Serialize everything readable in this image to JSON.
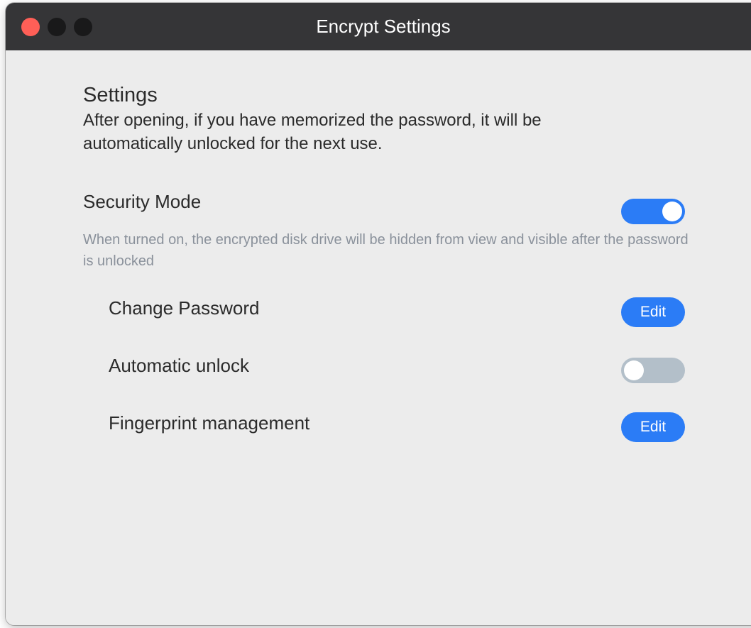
{
  "window": {
    "title": "Encrypt Settings"
  },
  "settings": {
    "heading": "Settings",
    "description": "After opening, if you have memorized the password, it will be automatically unlocked for the next use."
  },
  "security_mode": {
    "label": "Security Mode",
    "enabled": true,
    "note": "When turned on, the encrypted disk drive will be hidden from view and visible after the password is unlocked"
  },
  "rows": {
    "change_password": {
      "label": "Change Password",
      "button_label": "Edit"
    },
    "automatic_unlock": {
      "label": "Automatic unlock",
      "enabled": false
    },
    "fingerprint": {
      "label": "Fingerprint management",
      "button_label": "Edit"
    }
  },
  "colors": {
    "accent": "#2b7cf6",
    "toggle_off": "#b3bfc9",
    "titlebar": "#353537",
    "close": "#fe5f57"
  }
}
